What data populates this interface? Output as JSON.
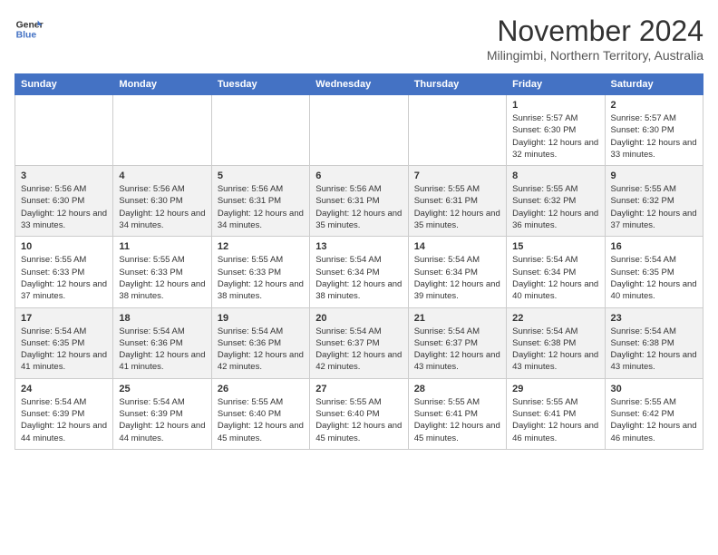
{
  "header": {
    "logo_line1": "General",
    "logo_line2": "Blue",
    "title": "November 2024",
    "subtitle": "Milingimbi, Northern Territory, Australia"
  },
  "calendar": {
    "days_of_week": [
      "Sunday",
      "Monday",
      "Tuesday",
      "Wednesday",
      "Thursday",
      "Friday",
      "Saturday"
    ],
    "weeks": [
      {
        "days": [
          {
            "date": "",
            "info": ""
          },
          {
            "date": "",
            "info": ""
          },
          {
            "date": "",
            "info": ""
          },
          {
            "date": "",
            "info": ""
          },
          {
            "date": "",
            "info": ""
          },
          {
            "date": "1",
            "info": "Sunrise: 5:57 AM\nSunset: 6:30 PM\nDaylight: 12 hours and 32 minutes."
          },
          {
            "date": "2",
            "info": "Sunrise: 5:57 AM\nSunset: 6:30 PM\nDaylight: 12 hours and 33 minutes."
          }
        ]
      },
      {
        "days": [
          {
            "date": "3",
            "info": "Sunrise: 5:56 AM\nSunset: 6:30 PM\nDaylight: 12 hours and 33 minutes."
          },
          {
            "date": "4",
            "info": "Sunrise: 5:56 AM\nSunset: 6:30 PM\nDaylight: 12 hours and 34 minutes."
          },
          {
            "date": "5",
            "info": "Sunrise: 5:56 AM\nSunset: 6:31 PM\nDaylight: 12 hours and 34 minutes."
          },
          {
            "date": "6",
            "info": "Sunrise: 5:56 AM\nSunset: 6:31 PM\nDaylight: 12 hours and 35 minutes."
          },
          {
            "date": "7",
            "info": "Sunrise: 5:55 AM\nSunset: 6:31 PM\nDaylight: 12 hours and 35 minutes."
          },
          {
            "date": "8",
            "info": "Sunrise: 5:55 AM\nSunset: 6:32 PM\nDaylight: 12 hours and 36 minutes."
          },
          {
            "date": "9",
            "info": "Sunrise: 5:55 AM\nSunset: 6:32 PM\nDaylight: 12 hours and 37 minutes."
          }
        ]
      },
      {
        "days": [
          {
            "date": "10",
            "info": "Sunrise: 5:55 AM\nSunset: 6:33 PM\nDaylight: 12 hours and 37 minutes."
          },
          {
            "date": "11",
            "info": "Sunrise: 5:55 AM\nSunset: 6:33 PM\nDaylight: 12 hours and 38 minutes."
          },
          {
            "date": "12",
            "info": "Sunrise: 5:55 AM\nSunset: 6:33 PM\nDaylight: 12 hours and 38 minutes."
          },
          {
            "date": "13",
            "info": "Sunrise: 5:54 AM\nSunset: 6:34 PM\nDaylight: 12 hours and 38 minutes."
          },
          {
            "date": "14",
            "info": "Sunrise: 5:54 AM\nSunset: 6:34 PM\nDaylight: 12 hours and 39 minutes."
          },
          {
            "date": "15",
            "info": "Sunrise: 5:54 AM\nSunset: 6:34 PM\nDaylight: 12 hours and 40 minutes."
          },
          {
            "date": "16",
            "info": "Sunrise: 5:54 AM\nSunset: 6:35 PM\nDaylight: 12 hours and 40 minutes."
          }
        ]
      },
      {
        "days": [
          {
            "date": "17",
            "info": "Sunrise: 5:54 AM\nSunset: 6:35 PM\nDaylight: 12 hours and 41 minutes."
          },
          {
            "date": "18",
            "info": "Sunrise: 5:54 AM\nSunset: 6:36 PM\nDaylight: 12 hours and 41 minutes."
          },
          {
            "date": "19",
            "info": "Sunrise: 5:54 AM\nSunset: 6:36 PM\nDaylight: 12 hours and 42 minutes."
          },
          {
            "date": "20",
            "info": "Sunrise: 5:54 AM\nSunset: 6:37 PM\nDaylight: 12 hours and 42 minutes."
          },
          {
            "date": "21",
            "info": "Sunrise: 5:54 AM\nSunset: 6:37 PM\nDaylight: 12 hours and 43 minutes."
          },
          {
            "date": "22",
            "info": "Sunrise: 5:54 AM\nSunset: 6:38 PM\nDaylight: 12 hours and 43 minutes."
          },
          {
            "date": "23",
            "info": "Sunrise: 5:54 AM\nSunset: 6:38 PM\nDaylight: 12 hours and 43 minutes."
          }
        ]
      },
      {
        "days": [
          {
            "date": "24",
            "info": "Sunrise: 5:54 AM\nSunset: 6:39 PM\nDaylight: 12 hours and 44 minutes."
          },
          {
            "date": "25",
            "info": "Sunrise: 5:54 AM\nSunset: 6:39 PM\nDaylight: 12 hours and 44 minutes."
          },
          {
            "date": "26",
            "info": "Sunrise: 5:55 AM\nSunset: 6:40 PM\nDaylight: 12 hours and 45 minutes."
          },
          {
            "date": "27",
            "info": "Sunrise: 5:55 AM\nSunset: 6:40 PM\nDaylight: 12 hours and 45 minutes."
          },
          {
            "date": "28",
            "info": "Sunrise: 5:55 AM\nSunset: 6:41 PM\nDaylight: 12 hours and 45 minutes."
          },
          {
            "date": "29",
            "info": "Sunrise: 5:55 AM\nSunset: 6:41 PM\nDaylight: 12 hours and 46 minutes."
          },
          {
            "date": "30",
            "info": "Sunrise: 5:55 AM\nSunset: 6:42 PM\nDaylight: 12 hours and 46 minutes."
          }
        ]
      }
    ]
  }
}
